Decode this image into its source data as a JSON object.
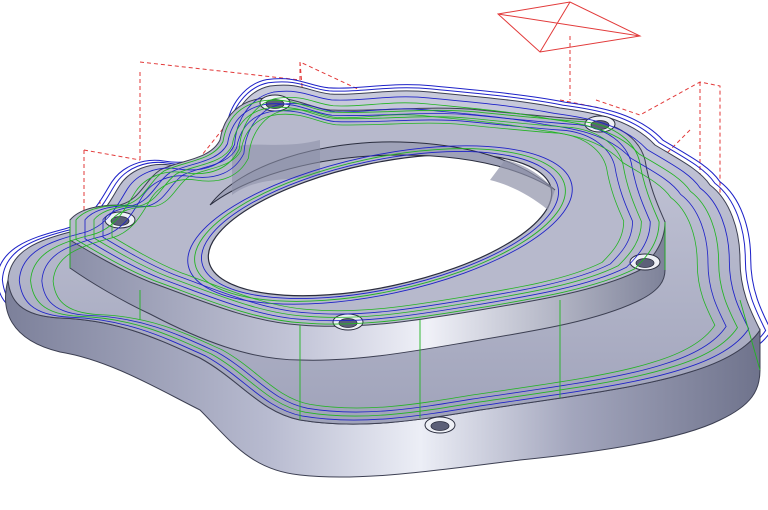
{
  "viewport": {
    "view": "isometric",
    "background": "#ffffff"
  },
  "model": {
    "part": "flange",
    "bolt_holes": 6,
    "center_bore": true,
    "body_color": "#a9acc4",
    "body_shadow": "#6c7088",
    "body_highlight": "#e8e9f3"
  },
  "toolpaths": {
    "colors": {
      "cut_moves": "#1e22c8",
      "linking_moves": "#22b422",
      "rapid_moves": "#e23a3a"
    },
    "passes": [
      "outer_contour",
      "boss_contour",
      "bore_contour"
    ]
  },
  "tool_indicator": {
    "icon": "tool-cone-icon",
    "color": "#e23a3a"
  }
}
